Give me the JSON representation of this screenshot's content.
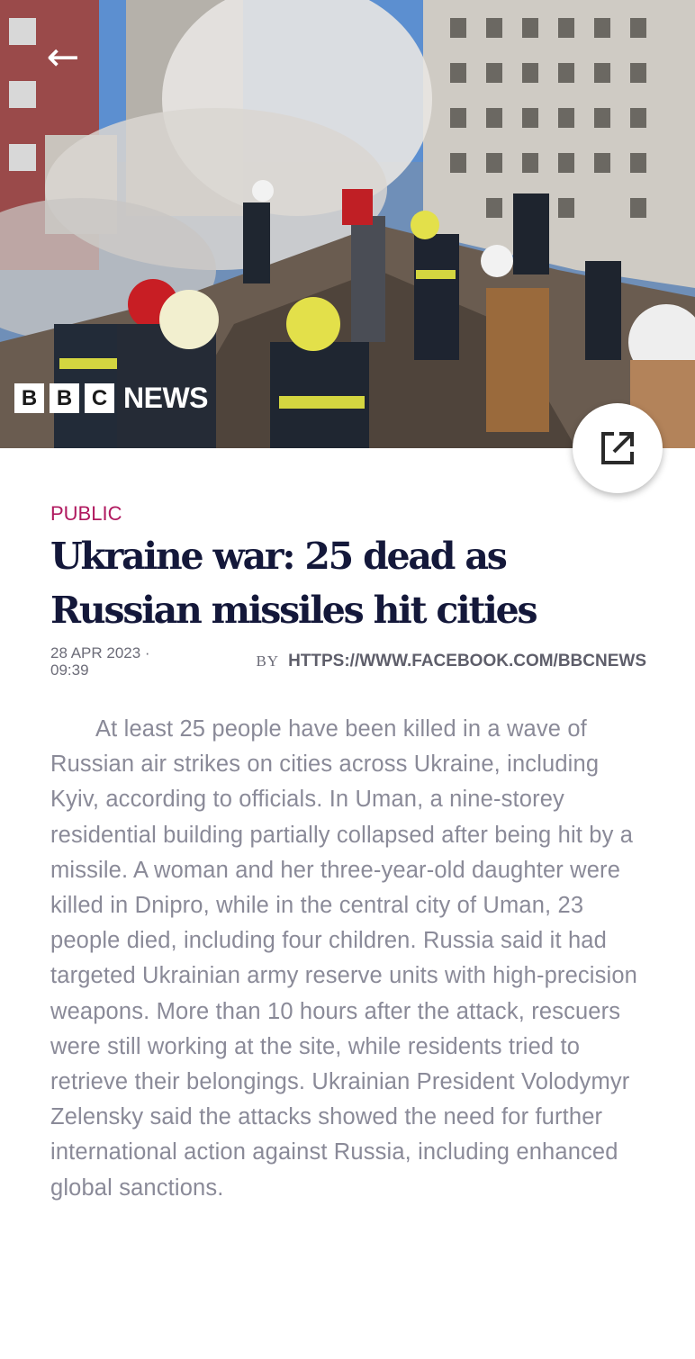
{
  "hero": {
    "image_alt": "Rescue workers in helmets amid smoke and rubble beside a damaged apartment building",
    "logo_blocks": [
      "B",
      "B",
      "C"
    ],
    "logo_word": "NEWS"
  },
  "nav": {
    "back_glyph": "←"
  },
  "article": {
    "category": "PUBLIC",
    "title": "Ukraine war: 25 dead as Russian missiles hit cities",
    "date": "28 APR 2023 · 09:39",
    "by_label": "BY",
    "author": "HTTPS://WWW.FACEBOOK.COM/BBCNEWS",
    "body": "At least 25 people have been killed in a wave of Russian air strikes on cities across Ukraine, including Kyiv, according to officials. In Uman, a nine-storey residential building partially collapsed after being hit by a missile. A woman and her three-year-old daughter were killed in Dnipro, while in the central city of Uman, 23 people died, including four children. Russia said it had targeted Ukrainian army reserve units with high-precision weapons. More than 10 hours after the attack, rescuers were still working at the site, while residents tried to retrieve their belongings. Ukrainian President Volodymyr Zelensky said the attacks showed the need for further international action against Russia, including enhanced global sanctions."
  },
  "colors": {
    "category": "#b0195f",
    "title": "#14183a",
    "body": "#8a8a98",
    "meta": "#6c6c78"
  },
  "icons": {
    "open_external": "open-in-new-icon",
    "back": "back-arrow-icon"
  }
}
